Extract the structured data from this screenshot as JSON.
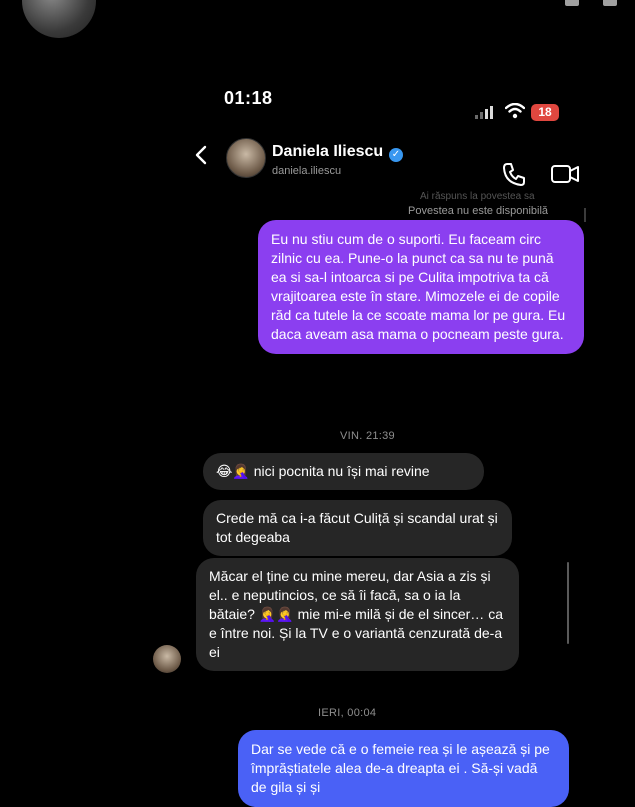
{
  "status_bar": {
    "time": "01:18",
    "battery": "18"
  },
  "header": {
    "name": "Daniela Iliescu",
    "handle": "daniela.iliescu",
    "verified_color": "#3897f0"
  },
  "story_reply": {
    "subtitle": "Ai răspuns la povestea sa",
    "unavailable": "Povestea nu este disponibilă"
  },
  "messages": {
    "out_1": "Eu nu stiu cum de o suporti. Eu faceam circ zilnic cu ea. Pune-o la punct ca sa nu te pună ea si sa-l intoarca si pe Culita impotriva ta că vrajitoarea este în stare. Mimozele ei de copile răd ca tutele la ce scoate mama lor pe gura. Eu daca aveam asa mama o pocneam peste gura.",
    "ts_1": "VIN. 21:39",
    "in_1_emoji": "😂🤦‍♀️",
    "in_1": "nici pocnita nu își mai revine",
    "in_2": "Crede mă ca i-a făcut Culiță și scandal urat și tot degeaba",
    "in_3_a": "Măcar el ține cu mine mereu, dar Asia a zis și el.. e neputincios, ce să îi facă, sa o ia la bătaie?",
    "in_3_emoji": "🤦‍♀️🤦‍♀️",
    "in_3_b": "mie mi-e milă și de el sincer… ca e între noi. Și la TV e o variantă cenzurată de-a ei",
    "ts_2": "IERI, 00:04",
    "out_2": "Dar se vede că e o femeie rea  și le așează și pe împrăștiatele alea de-a dreapta ei . Să-și vadă de gila și și"
  },
  "colors": {
    "bubble_purple": "#8b3ff0",
    "bubble_blue": "#4a61f6",
    "bubble_gray": "#262626",
    "battery_red": "#e0473f"
  },
  "icons": [
    "back-chevron-icon",
    "verified-badge-icon",
    "phone-icon",
    "video-camera-icon",
    "wifi-icon",
    "signal-icon",
    "battery-icon"
  ]
}
